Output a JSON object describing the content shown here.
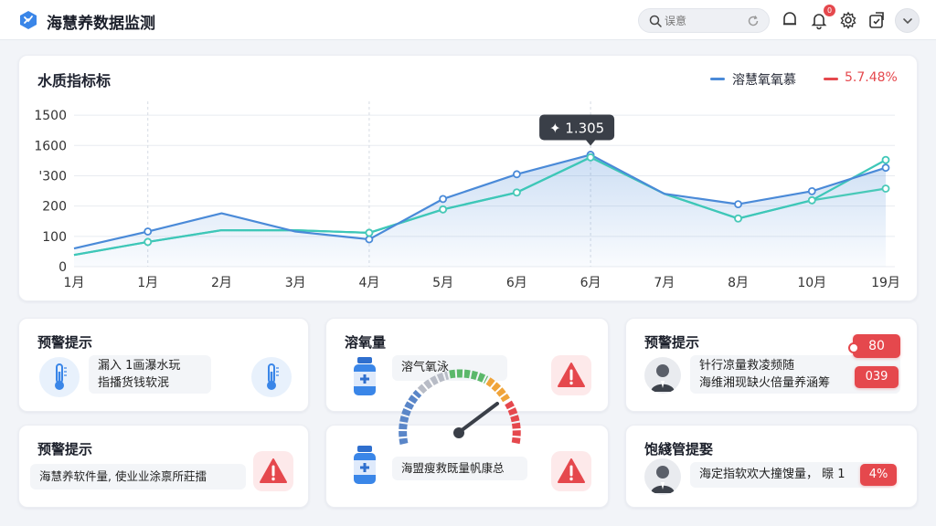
{
  "app": {
    "title": "海慧养数据监测"
  },
  "topbar": {
    "search_placeholder": "误意",
    "notification_count": "0"
  },
  "chart_panel": {
    "title": "水质指标标",
    "legend": [
      {
        "label": "溶慧氧氧慕",
        "color": "#4a8ad8"
      },
      {
        "label": "5.7.48%",
        "color": "#e5484d"
      }
    ],
    "tooltip": "✦ 1.305",
    "chart_data": {
      "type": "line",
      "categories": [
        "1月",
        "1月",
        "2月",
        "3月",
        "4月",
        "5月",
        "6月",
        "6月",
        "7月",
        "8月",
        "10月",
        "19月"
      ],
      "y_tick_labels": [
        "0",
        "100",
        "200",
        "'300",
        "1600",
        "1500"
      ],
      "ylim": [
        0,
        6
      ],
      "grid": true,
      "series": [
        {
          "name": "溶慧氧氧慕",
          "color": "#4a8ad8",
          "values": [
            0.7,
            1.35,
            2.05,
            1.35,
            1.05,
            2.6,
            3.55,
            4.3,
            2.8,
            2.4,
            2.9,
            3.8
          ]
        },
        {
          "color": "#3ec7b8",
          "values": [
            0.45,
            0.95,
            1.4,
            1.4,
            1.3,
            2.2,
            2.85,
            4.2,
            2.8,
            1.85,
            2.55,
            4.1
          ]
        },
        {
          "color": "#49c9b8",
          "values": [
            0.45,
            0.95,
            1.4,
            1.4,
            1.3,
            2.2,
            2.85,
            4.2,
            2.8,
            1.85,
            2.55,
            3.0
          ]
        }
      ]
    }
  },
  "cards": {
    "top_left": {
      "title": "预警提示",
      "text_line1": "漏入 1画瀑水玩",
      "text_line2": "指播货钱软泯"
    },
    "top_mid": {
      "title": "溶氧量",
      "text": "溶气氧泳"
    },
    "top_right": {
      "title": "预警提示",
      "text_line1": "针行凉量救凌频随",
      "text_line2": "海维湘现缺火倍量养涵筹",
      "tag_value": "80",
      "tag_value2": "039"
    },
    "bottom_left": {
      "title": "预警提示",
      "text": "海慧养软件量, 使业业涂禀所莊擂"
    },
    "bottom_mid": {
      "text": "海盟瘦救既量帆康总"
    },
    "bottom_right": {
      "title": "饱綫管提娶",
      "text": "海定指软欢大撞馊量， 暻 1",
      "tag_value": "4%"
    }
  },
  "colors": {
    "accent_blue": "#4a8ad8",
    "accent_teal": "#3ec7b8",
    "alert_red": "#e5484d"
  }
}
